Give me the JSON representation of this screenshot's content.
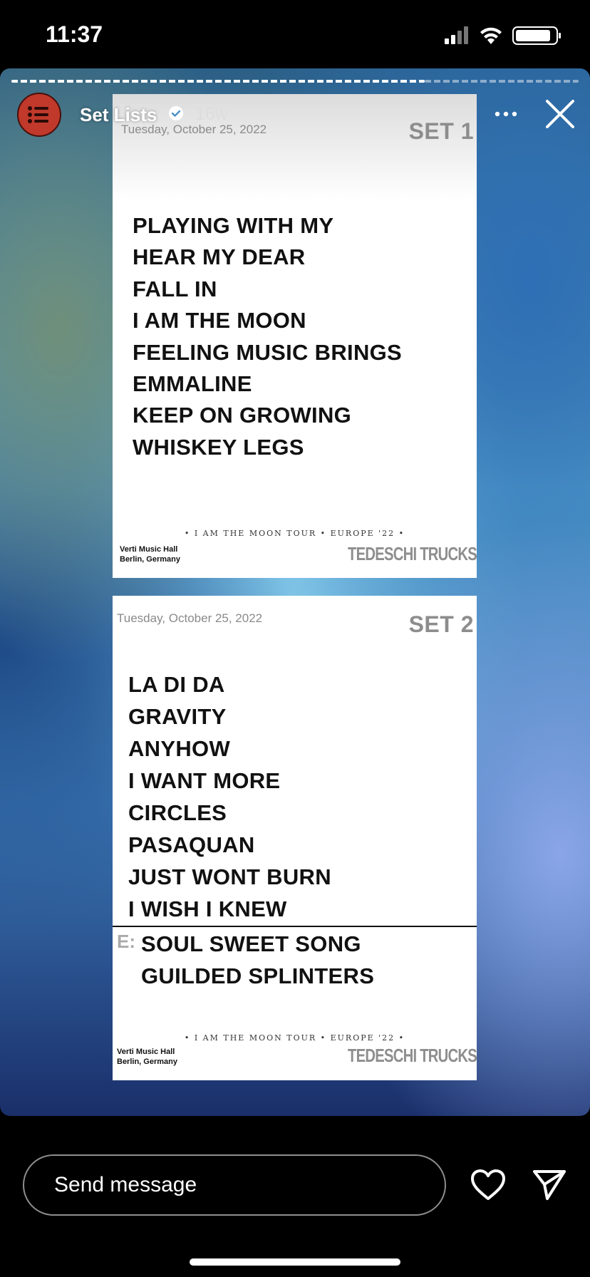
{
  "status_bar": {
    "time": "11:37"
  },
  "story": {
    "account_name": "Set Lists",
    "age": "16w",
    "icons": {
      "avatar": "list-icon",
      "verified": "verified-badge-icon",
      "more": "more-dots-icon",
      "close": "close-icon"
    }
  },
  "set1": {
    "date": "Tuesday, October 25, 2022",
    "label": "SET 1",
    "songs": [
      "PLAYING WITH MY",
      "HEAR MY DEAR",
      "FALL IN",
      "I AM THE MOON",
      "FEELING MUSIC BRINGS",
      "EMMALINE",
      "KEEP ON GROWING",
      "WHISKEY LEGS"
    ],
    "tour": "• I AM THE MOON TOUR • EUROPE '22 •",
    "venue_line1": "Verti Music Hall",
    "venue_line2": "Berlin, Germany",
    "band": "TEDESCHI TRUCKS"
  },
  "set2": {
    "date": "Tuesday, October 25, 2022",
    "label": "SET 2",
    "songs": [
      "LA DI DA",
      "GRAVITY",
      "ANYHOW",
      "I WANT MORE",
      "CIRCLES",
      "PASAQUAN",
      "JUST WONT BURN",
      "I WISH I KNEW"
    ],
    "encore_label": "E:",
    "encore_songs": [
      "SOUL SWEET SONG",
      "GUILDED SPLINTERS"
    ],
    "tour": "• I AM THE MOON TOUR • EUROPE '22 •",
    "venue_line1": "Verti Music Hall",
    "venue_line2": "Berlin, Germany",
    "band": "TEDESCHI TRUCKS"
  },
  "footer": {
    "message_placeholder": "Send message",
    "icons": {
      "like": "heart-icon",
      "share": "send-icon"
    }
  }
}
